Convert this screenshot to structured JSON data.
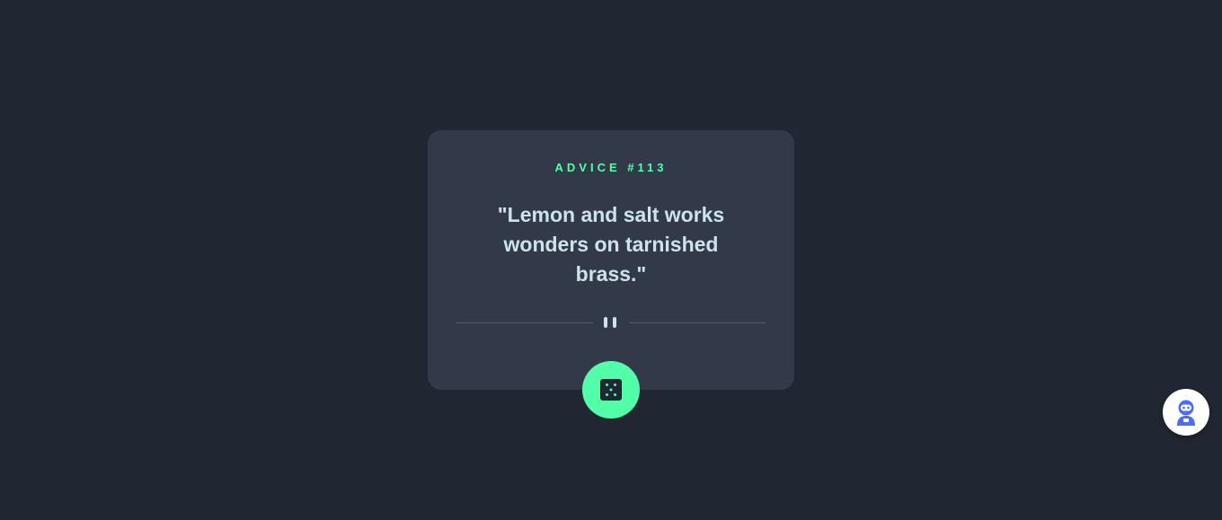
{
  "advice": {
    "label": "ADVICE #113",
    "quote": "\"Lemon and salt works wonders on tarnished brass.\""
  },
  "icons": {
    "divider": "pause-icon",
    "generate": "dice-icon",
    "helper": "robot-assistant-icon"
  },
  "colors": {
    "background": "#202632",
    "card": "#323a49",
    "accent": "#52ffa8",
    "text": "#cee3e9",
    "divider": "#4f5d74",
    "helper_icon": "#4a6cf7"
  }
}
